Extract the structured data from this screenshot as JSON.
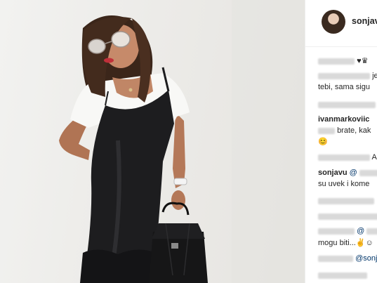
{
  "post": {
    "username": "sonjavu"
  },
  "comments": [
    {
      "text": "♥♛"
    },
    {
      "text": "je"
    },
    {
      "text": "tebi, sama sigu"
    },
    {
      "text": ""
    },
    {
      "user": "ivanmarkoviic",
      "text": "brate, kak"
    },
    {
      "text": "😊"
    },
    {
      "text": "Al"
    },
    {
      "user": "sonjavu",
      "mention": "@",
      "text": "su uvek i kome"
    },
    {
      "text": ""
    },
    {
      "mention": "@"
    },
    {
      "text": "mogu biti...✌️☺"
    },
    {
      "mention": "@sonj"
    }
  ],
  "colors": {
    "username": "#262626",
    "mention": "#003569",
    "blurred": "#d9d9d9"
  }
}
